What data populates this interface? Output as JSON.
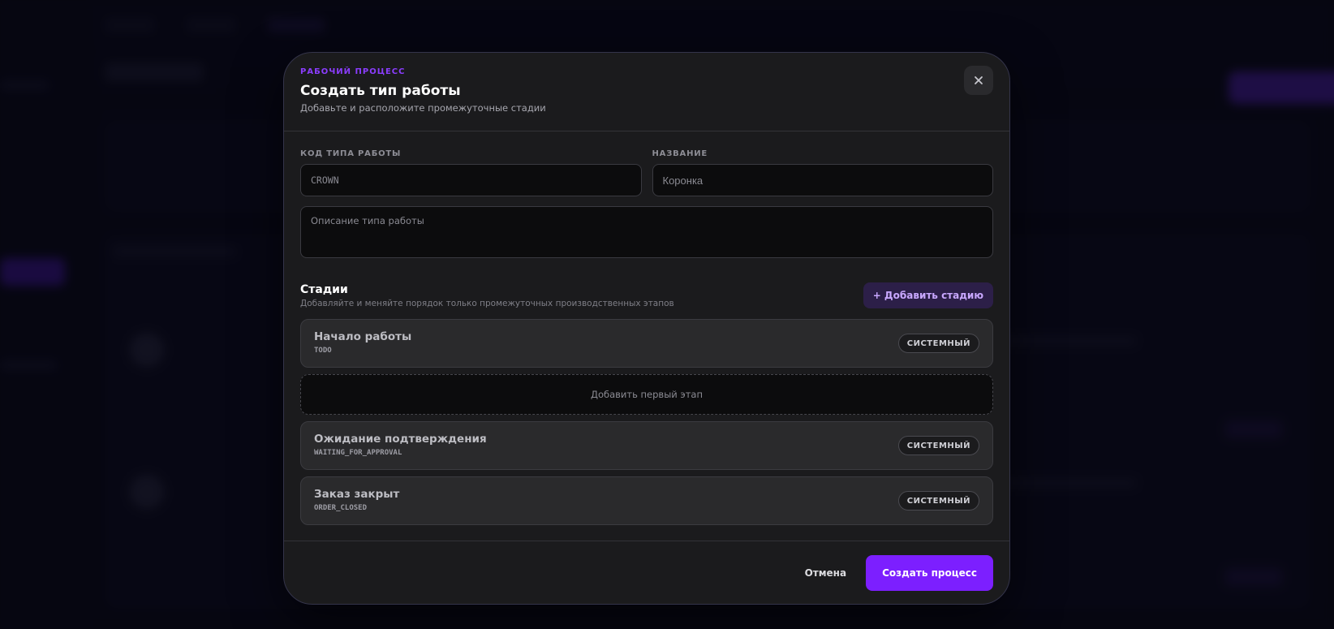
{
  "modal": {
    "eyebrow": "РАБОЧИЙ ПРОЦЕСС",
    "title": "Создать тип работы",
    "subtitle": "Добавьте и расположите промежуточные стадии",
    "close_icon": "close-icon"
  },
  "form": {
    "code_label": "КОД ТИПА РАБОТЫ",
    "code_placeholder": "CROWN",
    "name_label": "НАЗВАНИЕ",
    "name_placeholder": "Коронка",
    "description_placeholder": "Описание типа работы"
  },
  "stages": {
    "title": "Стадии",
    "subtitle": "Добавляйте и меняйте порядок только промежуточных производственных этапов",
    "add_button": "+ Добавить стадию",
    "add_first_label": "Добавить первый этап",
    "items": [
      {
        "name": "Начало работы",
        "code": "TODO",
        "badge": "СИСТЕМНЫЙ"
      },
      {
        "name": "Ожидание подтверждения",
        "code": "WAITING_FOR_APPROVAL",
        "badge": "СИСТЕМНЫЙ"
      },
      {
        "name": "Заказ закрыт",
        "code": "ORDER_CLOSED",
        "badge": "СИСТЕМНЫЙ"
      }
    ]
  },
  "footer": {
    "cancel_label": "Отмена",
    "submit_label": "Создать процесс"
  },
  "colors": {
    "accent": "#7c1fff",
    "eyebrow": "#8b3dff",
    "modal_bg": "#1b1b1d"
  }
}
